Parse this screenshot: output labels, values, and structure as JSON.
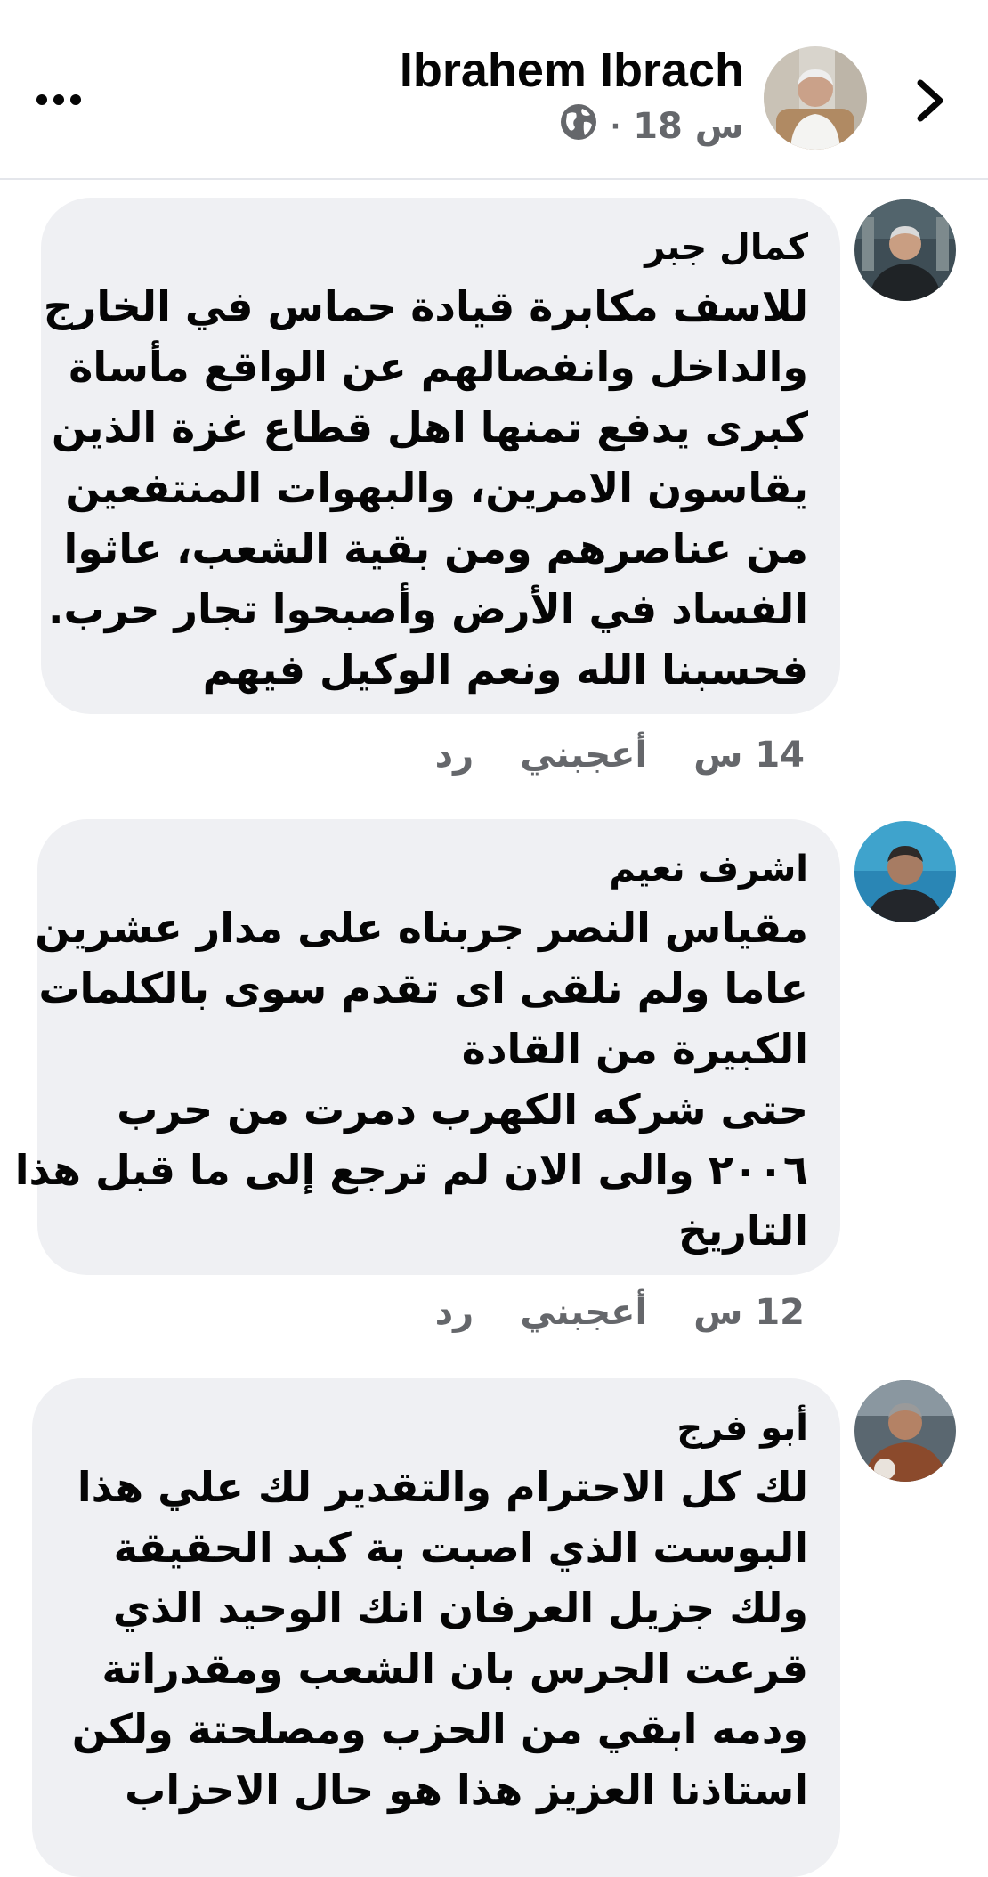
{
  "header": {
    "name": "Ibrahem Ibrach",
    "time": "18 س",
    "separator": "·",
    "audience_icon": "globe-icon",
    "more_icon": "more-horizontal-icon",
    "back_icon": "chevron-right-icon"
  },
  "comments": [
    {
      "author": "كمال جبر",
      "lines": [
        "للاسف مكابرة قيادة حماس في الخارج",
        "والداخل وانفصالهم عن الواقع مأساة",
        "كبرى يدفع تمنها اهل قطاع غزة الذين",
        "يقاسون الامرين، والبهوات  المنتفعين",
        "من عناصرهم ومن بقية الشعب، عاثوا",
        "الفساد في الأرض وأصبحوا تجار حرب.",
        "فحسبنا الله ونعم الوكيل فيهم"
      ],
      "time": "14 س",
      "like_label": "أعجبني",
      "reply_label": "رد"
    },
    {
      "author": "اشرف نعيم",
      "lines": [
        "مقياس النصر جربناه على مدار عشرين",
        "عاما ولم نلقى اى تقدم سوى بالكلمات",
        "الكبيرة من القادة",
        "حتى شركه الكهرب دمرت من حرب",
        "٢٠٠٦ والى الان لم ترجع إلى ما قبل هذا",
        "التاريخ"
      ],
      "time": "12 س",
      "like_label": "أعجبني",
      "reply_label": "رد"
    },
    {
      "author": "أبو فرج",
      "lines": [
        "لك كل الاحترام والتقدير لك علي هذا",
        "البوست الذي اصبت بة كبد الحقيقة",
        "ولك جزيل العرفان انك الوحيد الذي",
        "قرعت الجرس  بان الشعب ومقدراتة",
        "ودمه ابقي من الحزب  ومصلحتة ولكن",
        "استاذنا العزيز هذا هو حال الاحزاب"
      ]
    }
  ]
}
